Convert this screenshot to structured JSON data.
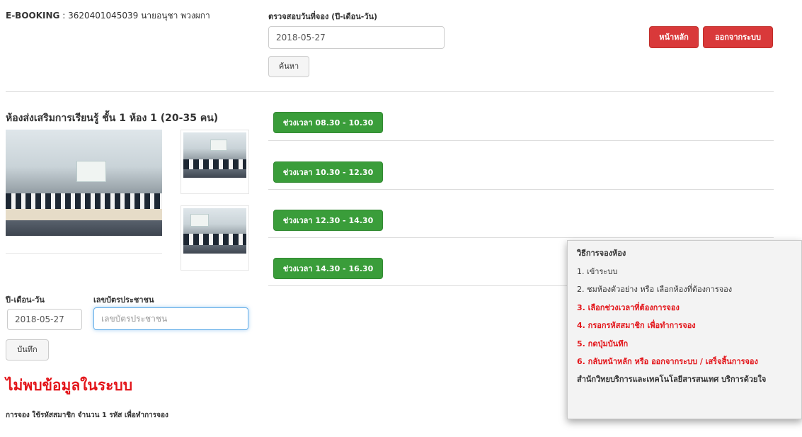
{
  "header": {
    "brand": "E-BOOKING",
    "separator": " : ",
    "user": "3620401045039 นายอนุชา พวงผกา"
  },
  "date_check": {
    "label": "ตรวจสอบวันที่จอง (ปี-เดือน-วัน)",
    "value": "2018-05-27",
    "search_button": "ค้นหา"
  },
  "top_buttons": {
    "home": "หน้าหลัก",
    "logout": "ออกจากระบบ"
  },
  "room": {
    "title": "ห้องส่งเสริมการเรียนรู้ ชั้น 1 ห้อง 1 (20-35 คน)"
  },
  "slots": [
    {
      "label": "ช่วงเวลา 08.30 - 10.30"
    },
    {
      "label": "ช่วงเวลา 10.30 - 12.30"
    },
    {
      "label": "ช่วงเวลา 12.30 - 14.30"
    },
    {
      "label": "ช่วงเวลา 14.30 - 16.30"
    }
  ],
  "form": {
    "date_label": "ปี-เดือน-วัน",
    "date_value": "2018-05-27",
    "id_label": "เลขบัตรประชาชน",
    "id_placeholder": "เลขบัตรประชาชน",
    "save_button": "บันทึก"
  },
  "not_found": "ไม่พบข้อมูลในระบบ",
  "note": "การจอง ใช้รหัสสมาชิก จำนวน 1 รหัส เพื่อทำการจอง",
  "help": {
    "title": "วิธีการจองห้อง",
    "steps": [
      "1. เข้าระบบ",
      "2. ชมห้องตัวอย่าง หรือ เลือกห้องที่ต้องการจอง",
      "3. เลือกช่วงเวลาที่ต้องการจอง",
      "4. กรอกรหัสสมาชิก เพื่อทำการจอง",
      "5. กดปุ่มบันทึก",
      "6. กลับหน้าหลัก หรือ ออกจากระบบ / เสร็จสิ้นการจอง"
    ],
    "footer": "สำนักวิทยบริการและเทคโนโลยีสารสนเทศ บริการด้วยใจ",
    "colors": {
      "highlight": "#e3151a",
      "normal": "#333333"
    }
  },
  "colors": {
    "danger": "#d9393a",
    "success": "#3a9d3a",
    "not_found": "#e3151a"
  }
}
